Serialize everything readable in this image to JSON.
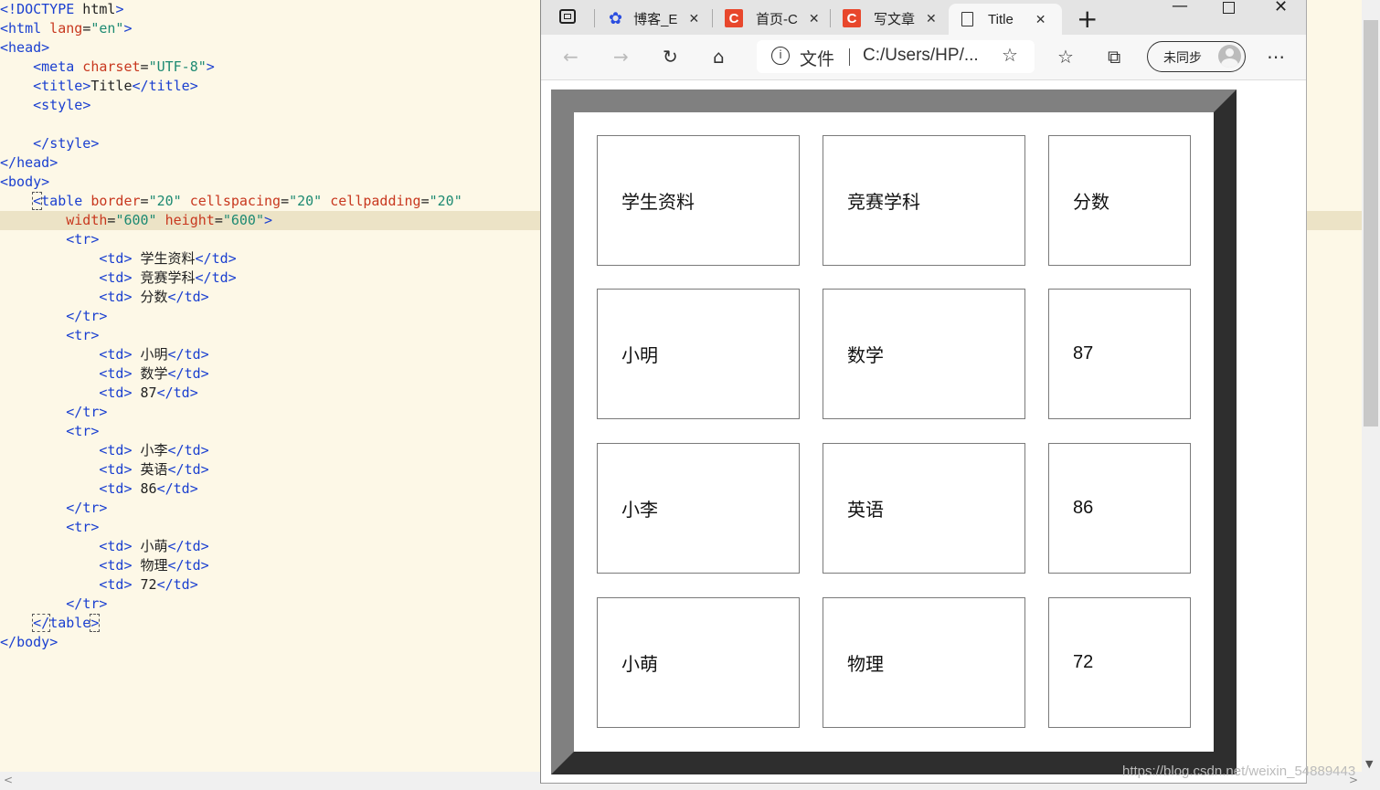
{
  "editor": {
    "lines": [
      [
        [
          "tk-br",
          "<!"
        ],
        [
          "tk-tag",
          "DOCTYPE"
        ],
        [
          "tk-txt",
          " html"
        ],
        [
          "tk-br",
          ">"
        ]
      ],
      [
        [
          "tk-br",
          "<"
        ],
        [
          "tk-tag",
          "html"
        ],
        [
          "tk-attr",
          " lang"
        ],
        [
          "tk-txt",
          "="
        ],
        [
          "tk-val",
          "\"en\""
        ],
        [
          "tk-br",
          ">"
        ]
      ],
      [
        [
          "tk-br",
          "<"
        ],
        [
          "tk-tag",
          "head"
        ],
        [
          "tk-br",
          ">"
        ]
      ],
      [
        [
          "tk-txt",
          "    "
        ],
        [
          "tk-br",
          "<"
        ],
        [
          "tk-tag",
          "meta"
        ],
        [
          "tk-attr",
          " charset"
        ],
        [
          "tk-txt",
          "="
        ],
        [
          "tk-val",
          "\"UTF-8\""
        ],
        [
          "tk-br",
          ">"
        ]
      ],
      [
        [
          "tk-txt",
          "    "
        ],
        [
          "tk-br",
          "<"
        ],
        [
          "tk-tag",
          "title"
        ],
        [
          "tk-br",
          ">"
        ],
        [
          "tk-txt",
          "Title"
        ],
        [
          "tk-br",
          "</"
        ],
        [
          "tk-tag",
          "title"
        ],
        [
          "tk-br",
          ">"
        ]
      ],
      [
        [
          "tk-txt",
          "    "
        ],
        [
          "tk-br",
          "<"
        ],
        [
          "tk-tag",
          "style"
        ],
        [
          "tk-br",
          ">"
        ]
      ],
      [],
      [
        [
          "tk-txt",
          "    "
        ],
        [
          "tk-br",
          "</"
        ],
        [
          "tk-tag",
          "style"
        ],
        [
          "tk-br",
          ">"
        ]
      ],
      [
        [
          "tk-br",
          "</"
        ],
        [
          "tk-tag",
          "head"
        ],
        [
          "tk-br",
          ">"
        ]
      ],
      [
        [
          "tk-br",
          "<"
        ],
        [
          "tk-tag",
          "body"
        ],
        [
          "tk-br",
          ">"
        ]
      ],
      [
        [
          "tk-txt",
          "    "
        ],
        [
          "tk-br boxed",
          "<"
        ],
        [
          "tk-tag",
          "table"
        ],
        [
          "tk-attr",
          " border"
        ],
        [
          "tk-txt",
          "="
        ],
        [
          "tk-val",
          "\"20\""
        ],
        [
          "tk-attr",
          " cellspacing"
        ],
        [
          "tk-txt",
          "="
        ],
        [
          "tk-val",
          "\"20\""
        ],
        [
          "tk-attr",
          " cellpadding"
        ],
        [
          "tk-txt",
          "="
        ],
        [
          "tk-val",
          "\"20\""
        ]
      ],
      [
        [
          "tk-txt",
          "        "
        ],
        [
          "tk-attr",
          "width"
        ],
        [
          "tk-txt",
          "="
        ],
        [
          "tk-val",
          "\"600\""
        ],
        [
          "tk-attr",
          " height"
        ],
        [
          "tk-txt",
          "="
        ],
        [
          "tk-val",
          "\"600\""
        ],
        [
          "tk-br",
          ">"
        ]
      ],
      [
        [
          "tk-txt",
          "        "
        ],
        [
          "tk-br",
          "<"
        ],
        [
          "tk-tag",
          "tr"
        ],
        [
          "tk-br",
          ">"
        ]
      ],
      [
        [
          "tk-txt",
          "            "
        ],
        [
          "tk-br",
          "<"
        ],
        [
          "tk-tag",
          "td"
        ],
        [
          "tk-br",
          ">"
        ],
        [
          "tk-txt",
          " 学生资料"
        ],
        [
          "tk-br",
          "</"
        ],
        [
          "tk-tag",
          "td"
        ],
        [
          "tk-br",
          ">"
        ]
      ],
      [
        [
          "tk-txt",
          "            "
        ],
        [
          "tk-br",
          "<"
        ],
        [
          "tk-tag",
          "td"
        ],
        [
          "tk-br",
          ">"
        ],
        [
          "tk-txt",
          " 竞赛学科"
        ],
        [
          "tk-br",
          "</"
        ],
        [
          "tk-tag",
          "td"
        ],
        [
          "tk-br",
          ">"
        ]
      ],
      [
        [
          "tk-txt",
          "            "
        ],
        [
          "tk-br",
          "<"
        ],
        [
          "tk-tag",
          "td"
        ],
        [
          "tk-br",
          ">"
        ],
        [
          "tk-txt",
          " 分数"
        ],
        [
          "tk-br",
          "</"
        ],
        [
          "tk-tag",
          "td"
        ],
        [
          "tk-br",
          ">"
        ]
      ],
      [
        [
          "tk-txt",
          "        "
        ],
        [
          "tk-br",
          "</"
        ],
        [
          "tk-tag",
          "tr"
        ],
        [
          "tk-br",
          ">"
        ]
      ],
      [
        [
          "tk-txt",
          "        "
        ],
        [
          "tk-br",
          "<"
        ],
        [
          "tk-tag",
          "tr"
        ],
        [
          "tk-br",
          ">"
        ]
      ],
      [
        [
          "tk-txt",
          "            "
        ],
        [
          "tk-br",
          "<"
        ],
        [
          "tk-tag",
          "td"
        ],
        [
          "tk-br",
          ">"
        ],
        [
          "tk-txt",
          " 小明"
        ],
        [
          "tk-br",
          "</"
        ],
        [
          "tk-tag",
          "td"
        ],
        [
          "tk-br",
          ">"
        ]
      ],
      [
        [
          "tk-txt",
          "            "
        ],
        [
          "tk-br",
          "<"
        ],
        [
          "tk-tag",
          "td"
        ],
        [
          "tk-br",
          ">"
        ],
        [
          "tk-txt",
          " 数学"
        ],
        [
          "tk-br",
          "</"
        ],
        [
          "tk-tag",
          "td"
        ],
        [
          "tk-br",
          ">"
        ]
      ],
      [
        [
          "tk-txt",
          "            "
        ],
        [
          "tk-br",
          "<"
        ],
        [
          "tk-tag",
          "td"
        ],
        [
          "tk-br",
          ">"
        ],
        [
          "tk-txt",
          " 87"
        ],
        [
          "tk-br",
          "</"
        ],
        [
          "tk-tag",
          "td"
        ],
        [
          "tk-br",
          ">"
        ]
      ],
      [
        [
          "tk-txt",
          "        "
        ],
        [
          "tk-br",
          "</"
        ],
        [
          "tk-tag",
          "tr"
        ],
        [
          "tk-br",
          ">"
        ]
      ],
      [
        [
          "tk-txt",
          "        "
        ],
        [
          "tk-br",
          "<"
        ],
        [
          "tk-tag",
          "tr"
        ],
        [
          "tk-br",
          ">"
        ]
      ],
      [
        [
          "tk-txt",
          "            "
        ],
        [
          "tk-br",
          "<"
        ],
        [
          "tk-tag",
          "td"
        ],
        [
          "tk-br",
          ">"
        ],
        [
          "tk-txt",
          " 小李"
        ],
        [
          "tk-br",
          "</"
        ],
        [
          "tk-tag",
          "td"
        ],
        [
          "tk-br",
          ">"
        ]
      ],
      [
        [
          "tk-txt",
          "            "
        ],
        [
          "tk-br",
          "<"
        ],
        [
          "tk-tag",
          "td"
        ],
        [
          "tk-br",
          ">"
        ],
        [
          "tk-txt",
          " 英语"
        ],
        [
          "tk-br",
          "</"
        ],
        [
          "tk-tag",
          "td"
        ],
        [
          "tk-br",
          ">"
        ]
      ],
      [
        [
          "tk-txt",
          "            "
        ],
        [
          "tk-br",
          "<"
        ],
        [
          "tk-tag",
          "td"
        ],
        [
          "tk-br",
          ">"
        ],
        [
          "tk-txt",
          " 86"
        ],
        [
          "tk-br",
          "</"
        ],
        [
          "tk-tag",
          "td"
        ],
        [
          "tk-br",
          ">"
        ]
      ],
      [
        [
          "tk-txt",
          "        "
        ],
        [
          "tk-br",
          "</"
        ],
        [
          "tk-tag",
          "tr"
        ],
        [
          "tk-br",
          ">"
        ]
      ],
      [
        [
          "tk-txt",
          "        "
        ],
        [
          "tk-br",
          "<"
        ],
        [
          "tk-tag",
          "tr"
        ],
        [
          "tk-br",
          ">"
        ]
      ],
      [
        [
          "tk-txt",
          "            "
        ],
        [
          "tk-br",
          "<"
        ],
        [
          "tk-tag",
          "td"
        ],
        [
          "tk-br",
          ">"
        ],
        [
          "tk-txt",
          " 小萌"
        ],
        [
          "tk-br",
          "</"
        ],
        [
          "tk-tag",
          "td"
        ],
        [
          "tk-br",
          ">"
        ]
      ],
      [
        [
          "tk-txt",
          "            "
        ],
        [
          "tk-br",
          "<"
        ],
        [
          "tk-tag",
          "td"
        ],
        [
          "tk-br",
          ">"
        ],
        [
          "tk-txt",
          " 物理"
        ],
        [
          "tk-br",
          "</"
        ],
        [
          "tk-tag",
          "td"
        ],
        [
          "tk-br",
          ">"
        ]
      ],
      [
        [
          "tk-txt",
          "            "
        ],
        [
          "tk-br",
          "<"
        ],
        [
          "tk-tag",
          "td"
        ],
        [
          "tk-br",
          ">"
        ],
        [
          "tk-txt",
          " 72"
        ],
        [
          "tk-br",
          "</"
        ],
        [
          "tk-tag",
          "td"
        ],
        [
          "tk-br",
          ">"
        ]
      ],
      [
        [
          "tk-txt",
          "        "
        ],
        [
          "tk-br",
          "</"
        ],
        [
          "tk-tag",
          "tr"
        ],
        [
          "tk-br",
          ">"
        ]
      ],
      [
        [
          "tk-txt",
          "    "
        ],
        [
          "tk-br boxed",
          "</"
        ],
        [
          "tk-tag",
          "table"
        ],
        [
          "tk-br boxed",
          ">"
        ]
      ],
      [
        [
          "tk-br",
          "</"
        ],
        [
          "tk-tag",
          "body"
        ],
        [
          "tk-br",
          ">"
        ]
      ]
    ],
    "highlighted_line": 11
  },
  "browser": {
    "tabs": [
      {
        "label": "博客_E",
        "icon": "baidu-paw-icon"
      },
      {
        "label": "首页-C",
        "icon": "csdn-icon"
      },
      {
        "label": "写文章",
        "icon": "csdn-icon"
      },
      {
        "label": "Title",
        "icon": "page-icon",
        "active": true
      }
    ],
    "new_tab": "+",
    "address": {
      "scheme_label": "文件",
      "url": "C:/Users/HP/..."
    },
    "profile_label": "未同步",
    "csdn_letter": "C"
  },
  "table": {
    "rows": [
      [
        "学生资料",
        "竞赛学科",
        "分数"
      ],
      [
        "小明",
        "数学",
        "87"
      ],
      [
        "小李",
        "英语",
        "86"
      ],
      [
        "小萌",
        "物理",
        "72"
      ]
    ]
  },
  "watermark": "https://blog.csdn.net/weixin_54889443"
}
